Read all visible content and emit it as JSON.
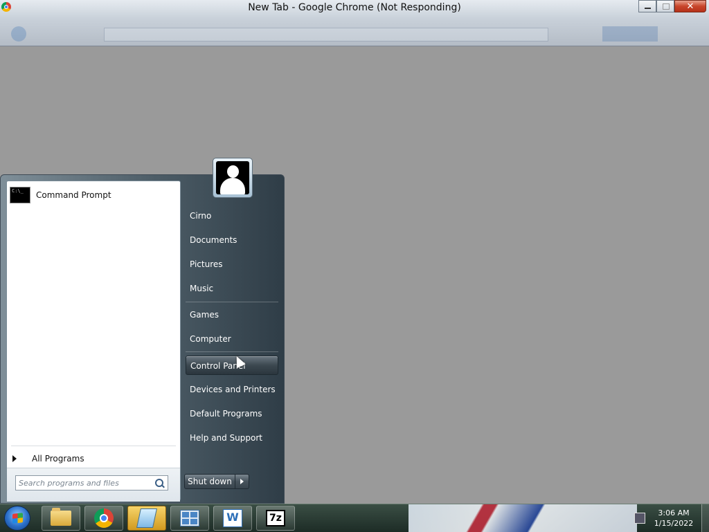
{
  "window": {
    "title": "New Tab - Google Chrome (Not Responding)"
  },
  "start_menu": {
    "pinned": [
      {
        "label": "Command Prompt",
        "icon": "command-prompt-icon"
      }
    ],
    "all_programs_label": "All Programs",
    "search": {
      "placeholder": "Search programs and files",
      "value": ""
    },
    "right_links": [
      {
        "label": "Cirno"
      },
      {
        "label": "Documents"
      },
      {
        "label": "Pictures"
      },
      {
        "label": "Music"
      },
      {
        "label": "Games"
      },
      {
        "label": "Computer"
      },
      {
        "label": "Control Panel",
        "highlighted": true
      },
      {
        "label": "Devices and Printers"
      },
      {
        "label": "Default Programs"
      },
      {
        "label": "Help and Support"
      }
    ],
    "shutdown_label": "Shut down"
  },
  "taskbar": {
    "apps": [
      {
        "name": "windows-explorer",
        "icon": "folder-icon"
      },
      {
        "name": "google-chrome",
        "icon": "chrome-icon"
      },
      {
        "name": "notepad",
        "icon": "notepad-icon",
        "active": true
      },
      {
        "name": "control-panel",
        "icon": "control-panel-icon"
      },
      {
        "name": "wps-writer",
        "icon": "word-icon",
        "glyph": "W"
      },
      {
        "name": "7-zip",
        "icon": "7zip-icon",
        "glyph": "7z"
      }
    ],
    "clock": {
      "time": "3:06 AM",
      "date": "1/15/2022"
    }
  },
  "colors": {
    "desktop_gray": "#9a9a9a",
    "start_menu_dark": "#2f3d47",
    "active_task": "#d19a1f"
  }
}
